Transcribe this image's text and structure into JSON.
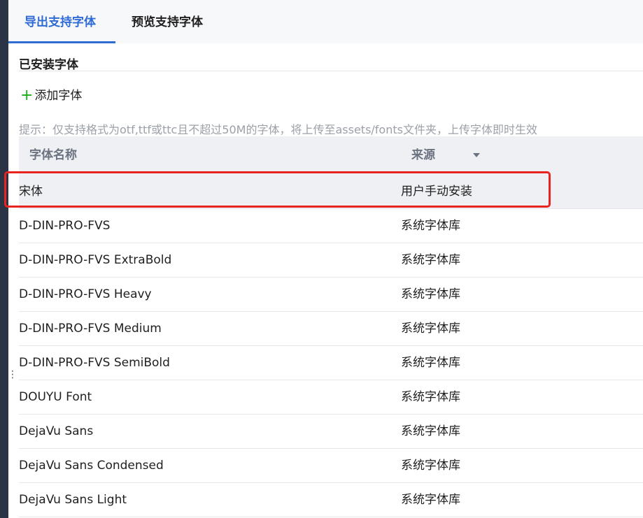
{
  "tabs": [
    {
      "label": "导出支持字体",
      "active": true
    },
    {
      "label": "预览支持字体",
      "active": false
    }
  ],
  "section": {
    "title": "已安装字体",
    "add_font_label": "添加字体",
    "hint": "提示：仅支持格式为otf,ttf或ttc且不超过50M的字体，将上传至assets/fonts文件夹，上传字体即时生效"
  },
  "table": {
    "columns": {
      "name": "字体名称",
      "source": "来源"
    },
    "rows": [
      {
        "name": "宋体",
        "source": "用户手动安装"
      },
      {
        "name": "D-DIN-PRO-FVS",
        "source": "系统字体库"
      },
      {
        "name": "D-DIN-PRO-FVS ExtraBold",
        "source": "系统字体库"
      },
      {
        "name": "D-DIN-PRO-FVS Heavy",
        "source": "系统字体库"
      },
      {
        "name": "D-DIN-PRO-FVS Medium",
        "source": "系统字体库"
      },
      {
        "name": "D-DIN-PRO-FVS SemiBold",
        "source": "系统字体库"
      },
      {
        "name": "DOUYU Font",
        "source": "系统字体库"
      },
      {
        "name": "DejaVu Sans",
        "source": "系统字体库"
      },
      {
        "name": "DejaVu Sans Condensed",
        "source": "系统字体库"
      },
      {
        "name": "DejaVu Sans Light",
        "source": "系统字体库"
      }
    ]
  },
  "colors": {
    "accent": "#2f6bd4",
    "highlight_box": "#e8241e",
    "add_icon": "#1aad19",
    "header_bg": "#eef0f4"
  },
  "icons": [
    "plus-icon",
    "sort-caret-icon",
    "drag-handle-icon"
  ]
}
